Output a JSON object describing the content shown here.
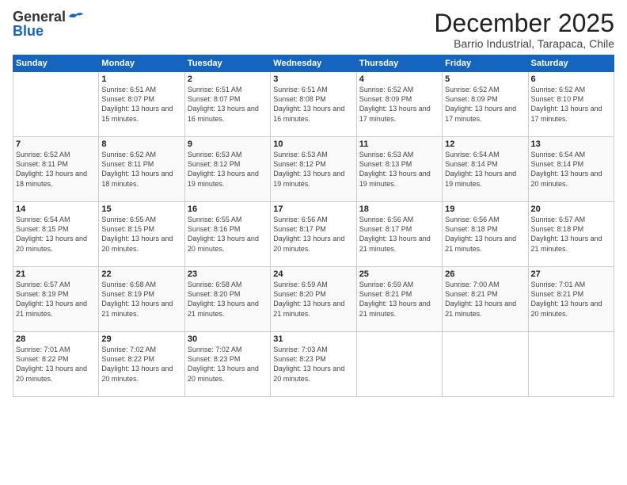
{
  "logo": {
    "general": "General",
    "blue": "Blue"
  },
  "header": {
    "month": "December 2025",
    "location": "Barrio Industrial, Tarapaca, Chile"
  },
  "weekdays": [
    "Sunday",
    "Monday",
    "Tuesday",
    "Wednesday",
    "Thursday",
    "Friday",
    "Saturday"
  ],
  "weeks": [
    [
      {
        "day": "",
        "sunrise": "",
        "sunset": "",
        "daylight": ""
      },
      {
        "day": "1",
        "sunrise": "Sunrise: 6:51 AM",
        "sunset": "Sunset: 8:07 PM",
        "daylight": "Daylight: 13 hours and 15 minutes."
      },
      {
        "day": "2",
        "sunrise": "Sunrise: 6:51 AM",
        "sunset": "Sunset: 8:07 PM",
        "daylight": "Daylight: 13 hours and 16 minutes."
      },
      {
        "day": "3",
        "sunrise": "Sunrise: 6:51 AM",
        "sunset": "Sunset: 8:08 PM",
        "daylight": "Daylight: 13 hours and 16 minutes."
      },
      {
        "day": "4",
        "sunrise": "Sunrise: 6:52 AM",
        "sunset": "Sunset: 8:09 PM",
        "daylight": "Daylight: 13 hours and 17 minutes."
      },
      {
        "day": "5",
        "sunrise": "Sunrise: 6:52 AM",
        "sunset": "Sunset: 8:09 PM",
        "daylight": "Daylight: 13 hours and 17 minutes."
      },
      {
        "day": "6",
        "sunrise": "Sunrise: 6:52 AM",
        "sunset": "Sunset: 8:10 PM",
        "daylight": "Daylight: 13 hours and 17 minutes."
      }
    ],
    [
      {
        "day": "7",
        "sunrise": "Sunrise: 6:52 AM",
        "sunset": "Sunset: 8:11 PM",
        "daylight": "Daylight: 13 hours and 18 minutes."
      },
      {
        "day": "8",
        "sunrise": "Sunrise: 6:52 AM",
        "sunset": "Sunset: 8:11 PM",
        "daylight": "Daylight: 13 hours and 18 minutes."
      },
      {
        "day": "9",
        "sunrise": "Sunrise: 6:53 AM",
        "sunset": "Sunset: 8:12 PM",
        "daylight": "Daylight: 13 hours and 19 minutes."
      },
      {
        "day": "10",
        "sunrise": "Sunrise: 6:53 AM",
        "sunset": "Sunset: 8:12 PM",
        "daylight": "Daylight: 13 hours and 19 minutes."
      },
      {
        "day": "11",
        "sunrise": "Sunrise: 6:53 AM",
        "sunset": "Sunset: 8:13 PM",
        "daylight": "Daylight: 13 hours and 19 minutes."
      },
      {
        "day": "12",
        "sunrise": "Sunrise: 6:54 AM",
        "sunset": "Sunset: 8:14 PM",
        "daylight": "Daylight: 13 hours and 19 minutes."
      },
      {
        "day": "13",
        "sunrise": "Sunrise: 6:54 AM",
        "sunset": "Sunset: 8:14 PM",
        "daylight": "Daylight: 13 hours and 20 minutes."
      }
    ],
    [
      {
        "day": "14",
        "sunrise": "Sunrise: 6:54 AM",
        "sunset": "Sunset: 8:15 PM",
        "daylight": "Daylight: 13 hours and 20 minutes."
      },
      {
        "day": "15",
        "sunrise": "Sunrise: 6:55 AM",
        "sunset": "Sunset: 8:15 PM",
        "daylight": "Daylight: 13 hours and 20 minutes."
      },
      {
        "day": "16",
        "sunrise": "Sunrise: 6:55 AM",
        "sunset": "Sunset: 8:16 PM",
        "daylight": "Daylight: 13 hours and 20 minutes."
      },
      {
        "day": "17",
        "sunrise": "Sunrise: 6:56 AM",
        "sunset": "Sunset: 8:17 PM",
        "daylight": "Daylight: 13 hours and 20 minutes."
      },
      {
        "day": "18",
        "sunrise": "Sunrise: 6:56 AM",
        "sunset": "Sunset: 8:17 PM",
        "daylight": "Daylight: 13 hours and 21 minutes."
      },
      {
        "day": "19",
        "sunrise": "Sunrise: 6:56 AM",
        "sunset": "Sunset: 8:18 PM",
        "daylight": "Daylight: 13 hours and 21 minutes."
      },
      {
        "day": "20",
        "sunrise": "Sunrise: 6:57 AM",
        "sunset": "Sunset: 8:18 PM",
        "daylight": "Daylight: 13 hours and 21 minutes."
      }
    ],
    [
      {
        "day": "21",
        "sunrise": "Sunrise: 6:57 AM",
        "sunset": "Sunset: 8:19 PM",
        "daylight": "Daylight: 13 hours and 21 minutes."
      },
      {
        "day": "22",
        "sunrise": "Sunrise: 6:58 AM",
        "sunset": "Sunset: 8:19 PM",
        "daylight": "Daylight: 13 hours and 21 minutes."
      },
      {
        "day": "23",
        "sunrise": "Sunrise: 6:58 AM",
        "sunset": "Sunset: 8:20 PM",
        "daylight": "Daylight: 13 hours and 21 minutes."
      },
      {
        "day": "24",
        "sunrise": "Sunrise: 6:59 AM",
        "sunset": "Sunset: 8:20 PM",
        "daylight": "Daylight: 13 hours and 21 minutes."
      },
      {
        "day": "25",
        "sunrise": "Sunrise: 6:59 AM",
        "sunset": "Sunset: 8:21 PM",
        "daylight": "Daylight: 13 hours and 21 minutes."
      },
      {
        "day": "26",
        "sunrise": "Sunrise: 7:00 AM",
        "sunset": "Sunset: 8:21 PM",
        "daylight": "Daylight: 13 hours and 21 minutes."
      },
      {
        "day": "27",
        "sunrise": "Sunrise: 7:01 AM",
        "sunset": "Sunset: 8:21 PM",
        "daylight": "Daylight: 13 hours and 20 minutes."
      }
    ],
    [
      {
        "day": "28",
        "sunrise": "Sunrise: 7:01 AM",
        "sunset": "Sunset: 8:22 PM",
        "daylight": "Daylight: 13 hours and 20 minutes."
      },
      {
        "day": "29",
        "sunrise": "Sunrise: 7:02 AM",
        "sunset": "Sunset: 8:22 PM",
        "daylight": "Daylight: 13 hours and 20 minutes."
      },
      {
        "day": "30",
        "sunrise": "Sunrise: 7:02 AM",
        "sunset": "Sunset: 8:23 PM",
        "daylight": "Daylight: 13 hours and 20 minutes."
      },
      {
        "day": "31",
        "sunrise": "Sunrise: 7:03 AM",
        "sunset": "Sunset: 8:23 PM",
        "daylight": "Daylight: 13 hours and 20 minutes."
      },
      {
        "day": "",
        "sunrise": "",
        "sunset": "",
        "daylight": ""
      },
      {
        "day": "",
        "sunrise": "",
        "sunset": "",
        "daylight": ""
      },
      {
        "day": "",
        "sunrise": "",
        "sunset": "",
        "daylight": ""
      }
    ]
  ]
}
